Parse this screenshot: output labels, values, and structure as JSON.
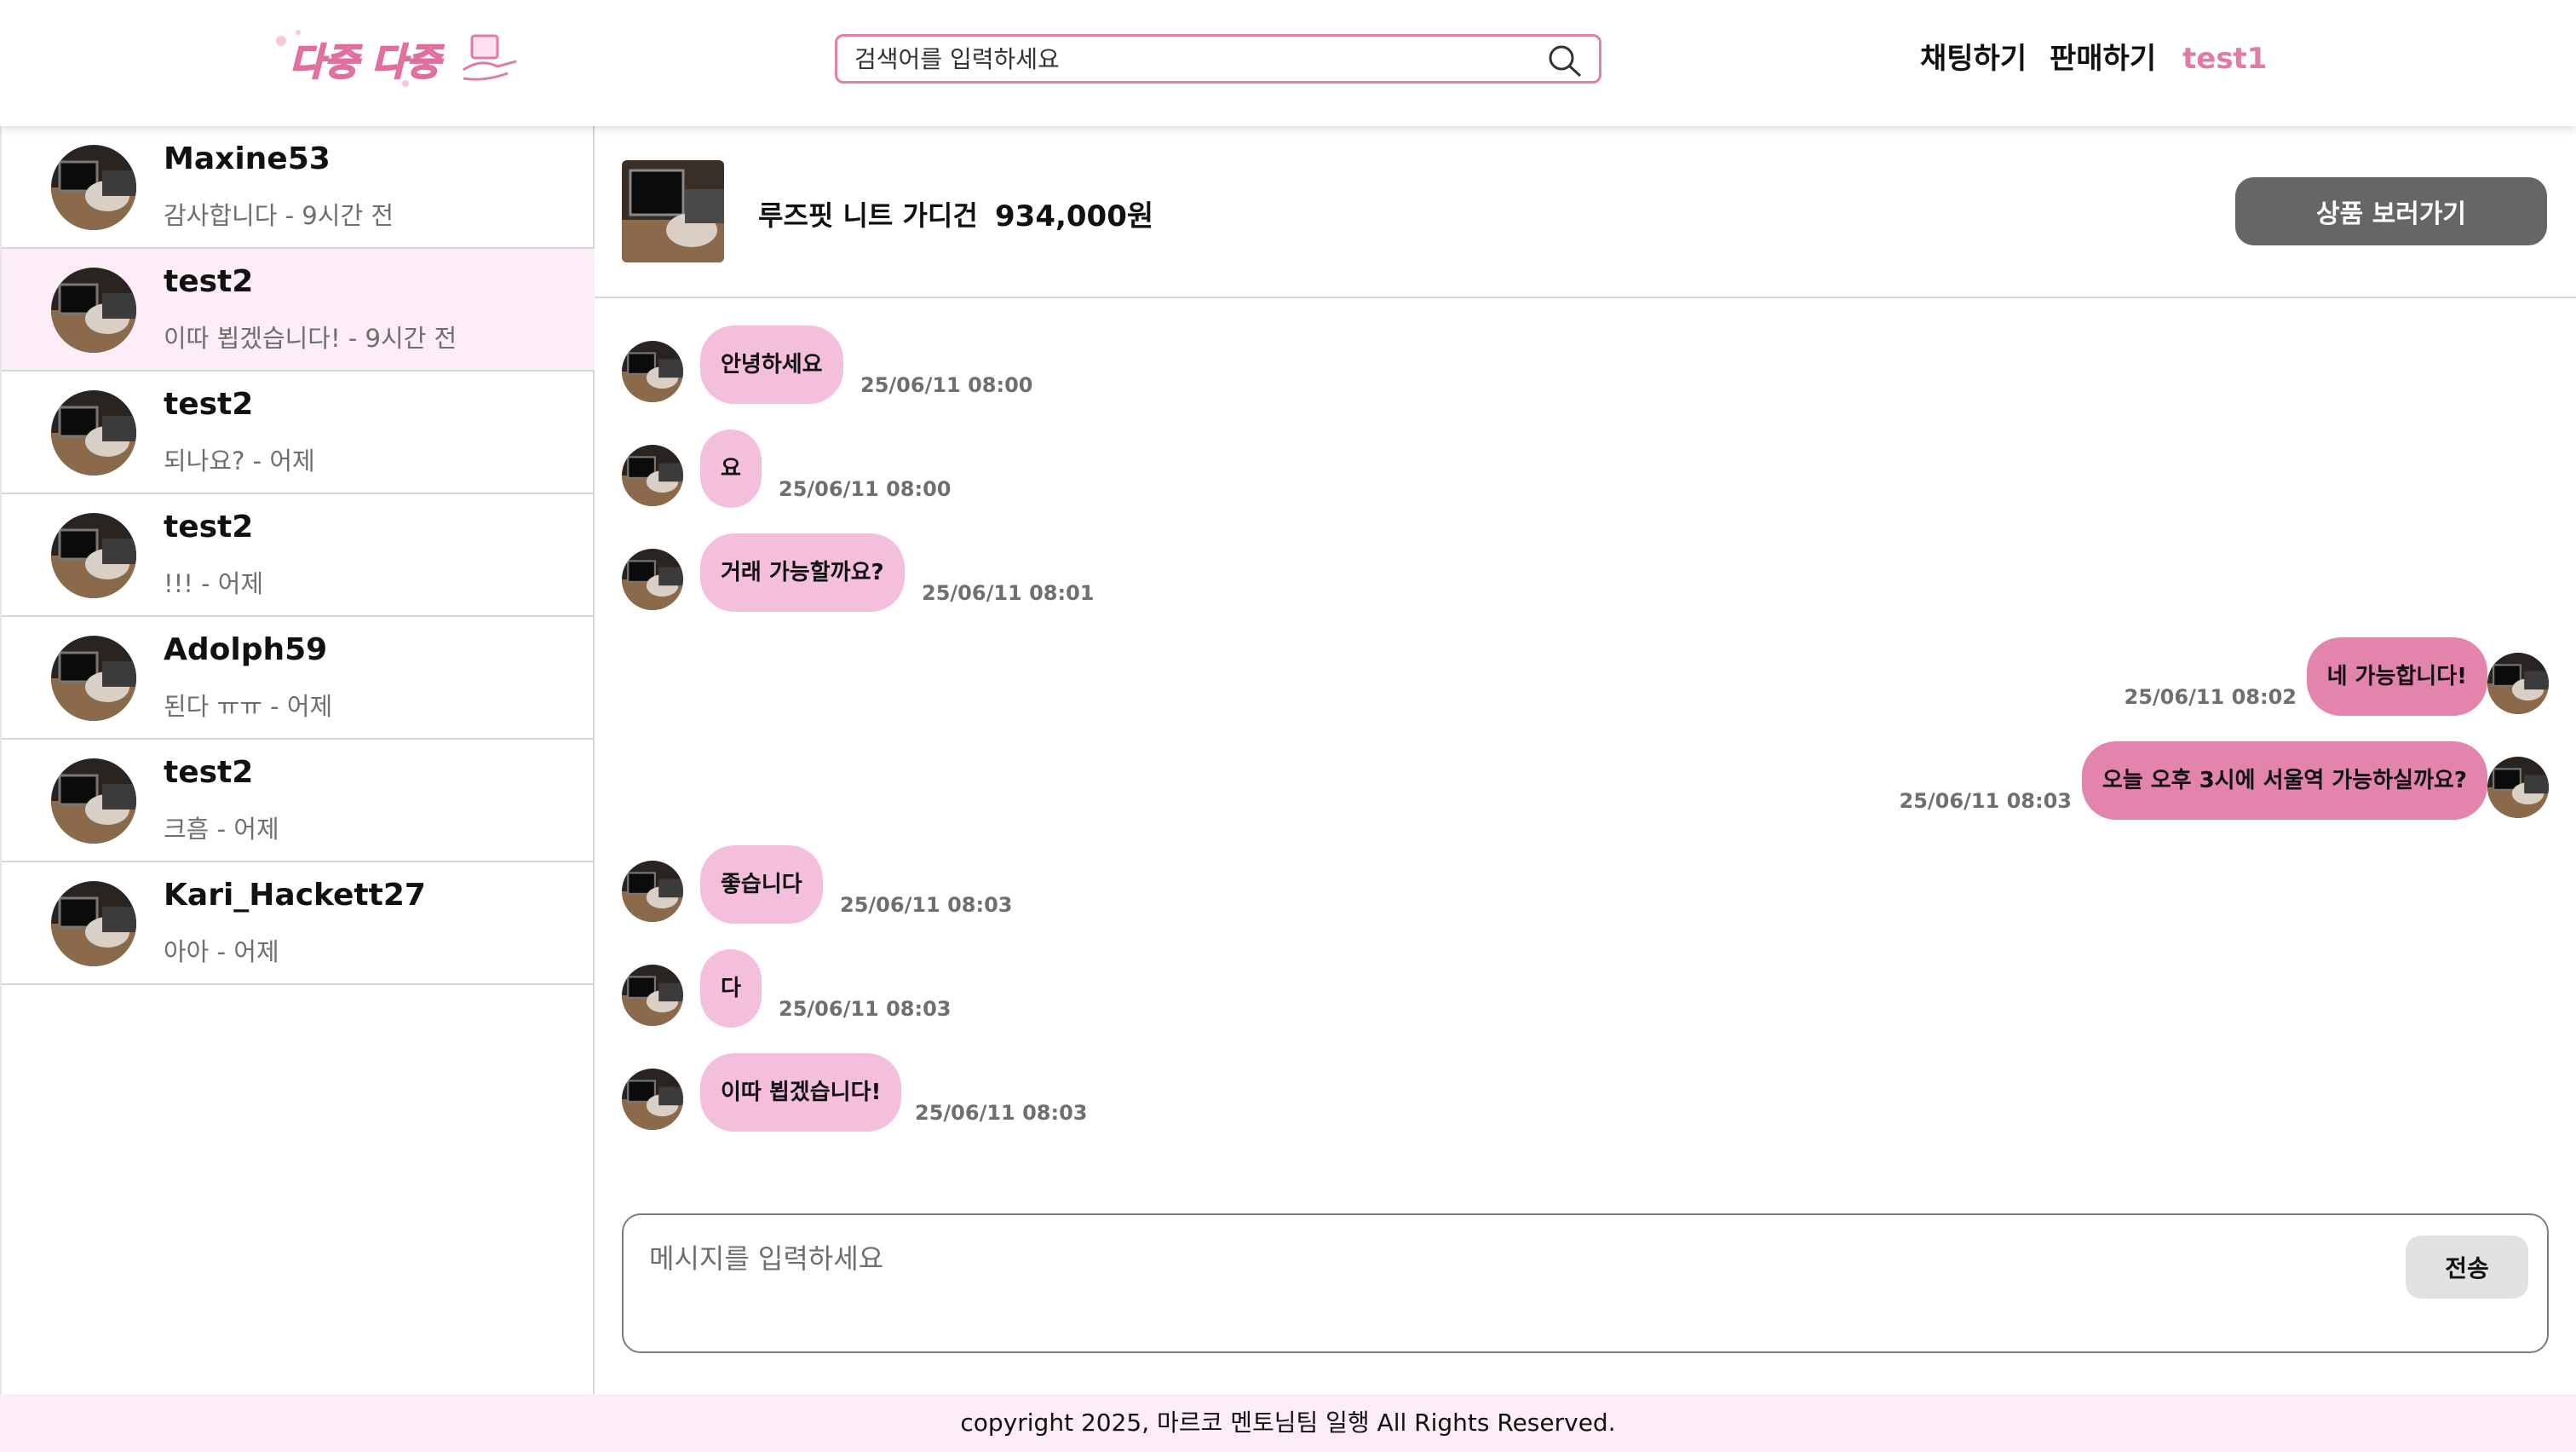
{
  "header": {
    "logo_text": "다중 다중",
    "search_placeholder": "검색어를 입력하세요",
    "nav_chat": "채팅하기",
    "nav_sell": "판매하기",
    "nav_user": "test1"
  },
  "sidebar": {
    "items": [
      {
        "name": "Maxine53",
        "last": "감사합니다 - 9시간 전"
      },
      {
        "name": "test2",
        "last": "이따 뵙겠습니다! - 9시간 전"
      },
      {
        "name": "test2",
        "last": "되나요? - 어제"
      },
      {
        "name": "test2",
        "last": "!!! - 어제"
      },
      {
        "name": "Adolph59",
        "last": "된다 ㅠㅠ - 어제"
      },
      {
        "name": "test2",
        "last": "크흠 - 어제"
      },
      {
        "name": "Kari_Hackett27",
        "last": "아아 - 어제"
      }
    ]
  },
  "product": {
    "name": "루즈핏 니트 가디건",
    "price": "934,000원",
    "goto_label": "상품 보러가기"
  },
  "messages": [
    {
      "text": "안녕하세요",
      "time": "25/06/11 08:00",
      "mine": false
    },
    {
      "text": "요",
      "time": "25/06/11 08:00",
      "mine": false
    },
    {
      "text": "거래 가능할까요?",
      "time": "25/06/11 08:01",
      "mine": false
    },
    {
      "text": "네 가능합니다!",
      "time": "25/06/11 08:02",
      "mine": true
    },
    {
      "text": "오늘 오후 3시에 서울역 가능하실까요?",
      "time": "25/06/11 08:03",
      "mine": true
    },
    {
      "text": "좋습니다",
      "time": "25/06/11 08:03",
      "mine": false
    },
    {
      "text": "다",
      "time": "25/06/11 08:03",
      "mine": false
    },
    {
      "text": "이따 뵙겠습니다!",
      "time": "25/06/11 08:03",
      "mine": false
    }
  ],
  "composer": {
    "placeholder": "메시지를 입력하세요",
    "send_label": "전송"
  },
  "footer": {
    "text": "copyright 2025, 마르코 멘토님팀 일행 All Rights Reserved."
  },
  "colors": {
    "accent": "#e07aa6",
    "bubble_other": "#f4bfdc",
    "bubble_mine": "#e384ad",
    "active_row": "#fcedf6",
    "button_dark": "#666666"
  }
}
